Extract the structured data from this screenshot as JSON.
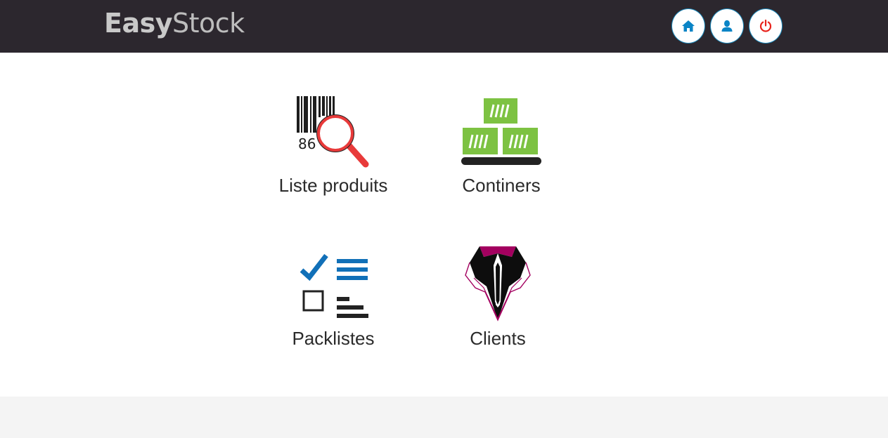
{
  "app": {
    "logo_part1": "Easy",
    "logo_part2": "Stock"
  },
  "header": {
    "buttons": [
      {
        "name": "home",
        "icon": "home-icon",
        "color": "#0a84c6"
      },
      {
        "name": "profile",
        "icon": "user-icon",
        "color": "#0a84c6"
      },
      {
        "name": "logout",
        "icon": "power-icon",
        "color": "#e8221b"
      }
    ]
  },
  "tiles": [
    {
      "label": "Liste produits",
      "icon": "barcode-search-icon",
      "barcode_number": "86"
    },
    {
      "label": "Continers",
      "icon": "containers-icon"
    },
    {
      "label": "Packlistes",
      "icon": "checklist-icon"
    },
    {
      "label": "Clients",
      "icon": "suit-icon"
    }
  ],
  "colors": {
    "header_bg": "#2c272e",
    "accent_blue": "#0a84c6",
    "container_green": "#7dc242",
    "magnifier_red": "#e83a3a",
    "suit_magenta": "#a3005f"
  }
}
